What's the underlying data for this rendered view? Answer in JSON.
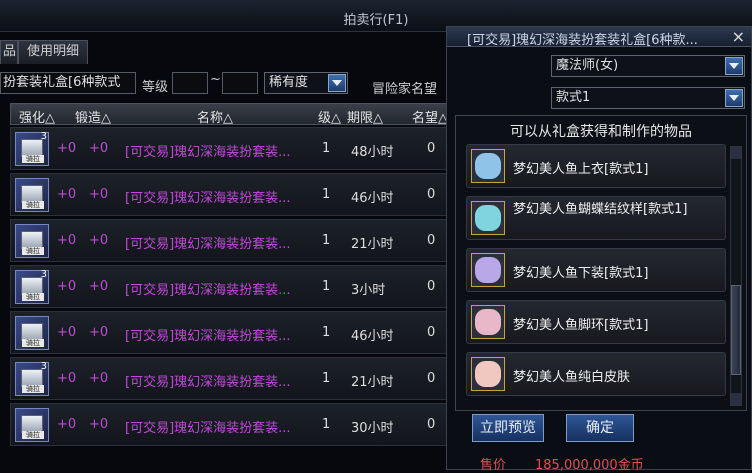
{
  "window": {
    "title": "拍卖行(F1)"
  },
  "tabs": [
    {
      "label": "品"
    },
    {
      "label": "使用明细"
    }
  ],
  "filter": {
    "search_value": "扮套装礼盒[6种款式",
    "level_label": "等级",
    "level_sep": "~",
    "rarity_label": "稀有度",
    "fame_label": "冒险家名望"
  },
  "table": {
    "headers": {
      "strengthen": "强化△",
      "forge": "锻造△",
      "name": "名称△",
      "level": "级△",
      "period": "期限△",
      "fame": "名望△"
    },
    "rows": [
      {
        "strengthen": "+0",
        "forge": "+0",
        "name": "[可交易]瑰幻深海装扮套装...",
        "level": "1",
        "period": "48小时",
        "fame": "0",
        "count": "3",
        "badge": "骑拉"
      },
      {
        "strengthen": "+0",
        "forge": "+0",
        "name": "[可交易]瑰幻深海装扮套装...",
        "level": "1",
        "period": "46小时",
        "fame": "0",
        "count": "",
        "badge": "骑拉"
      },
      {
        "strengthen": "+0",
        "forge": "+0",
        "name": "[可交易]瑰幻深海装扮套装...",
        "level": "1",
        "period": "21小时",
        "fame": "0",
        "count": "",
        "badge": "骑拉"
      },
      {
        "strengthen": "+0",
        "forge": "+0",
        "name": "[可交易]瑰幻深海装扮套装...",
        "level": "1",
        "period": "3小时",
        "fame": "0",
        "count": "3",
        "badge": "骑拉"
      },
      {
        "strengthen": "+0",
        "forge": "+0",
        "name": "[可交易]瑰幻深海装扮套装...",
        "level": "1",
        "period": "46小时",
        "fame": "0",
        "count": "",
        "badge": "骑拉"
      },
      {
        "strengthen": "+0",
        "forge": "+0",
        "name": "[可交易]瑰幻深海装扮套装...",
        "level": "1",
        "period": "21小时",
        "fame": "0",
        "count": "3",
        "badge": "骑拉"
      },
      {
        "strengthen": "+0",
        "forge": "+0",
        "name": "[可交易]瑰幻深海装扮套装...",
        "level": "1",
        "period": "30小时",
        "fame": "0",
        "count": "",
        "badge": "骑拉"
      }
    ]
  },
  "popup": {
    "title": "[可交易]瑰幻深海装扮套装礼盒[6种款...",
    "close": "×",
    "class_select": "魔法师(女)",
    "style_select": "款式1",
    "subtitle": "可以从礼盒获得和制作的物品",
    "items": [
      {
        "label": "梦幻美人鱼上衣[款式1]",
        "icon": "top-icon",
        "color": "#8fc4e8"
      },
      {
        "label": "梦幻美人鱼蝴蝶结纹样[款式1]",
        "icon": "bow-icon",
        "color": "#7fd4e0"
      },
      {
        "label": "梦幻美人鱼下装[款式1]",
        "icon": "bottom-icon",
        "color": "#b8a8e8"
      },
      {
        "label": "梦幻美人鱼脚环[款式1]",
        "icon": "anklet-icon",
        "color": "#e8b8c8"
      },
      {
        "label": "梦幻美人鱼纯白皮肤",
        "icon": "skin-icon",
        "color": "#f0c8c0"
      }
    ],
    "preview_button": "立即预览",
    "confirm_button": "确定"
  },
  "sale": {
    "price_label": "售价",
    "price_value": "185,000,000金币"
  },
  "colors": {
    "item_name": "#c04ad8",
    "accent": "#2e5696"
  }
}
